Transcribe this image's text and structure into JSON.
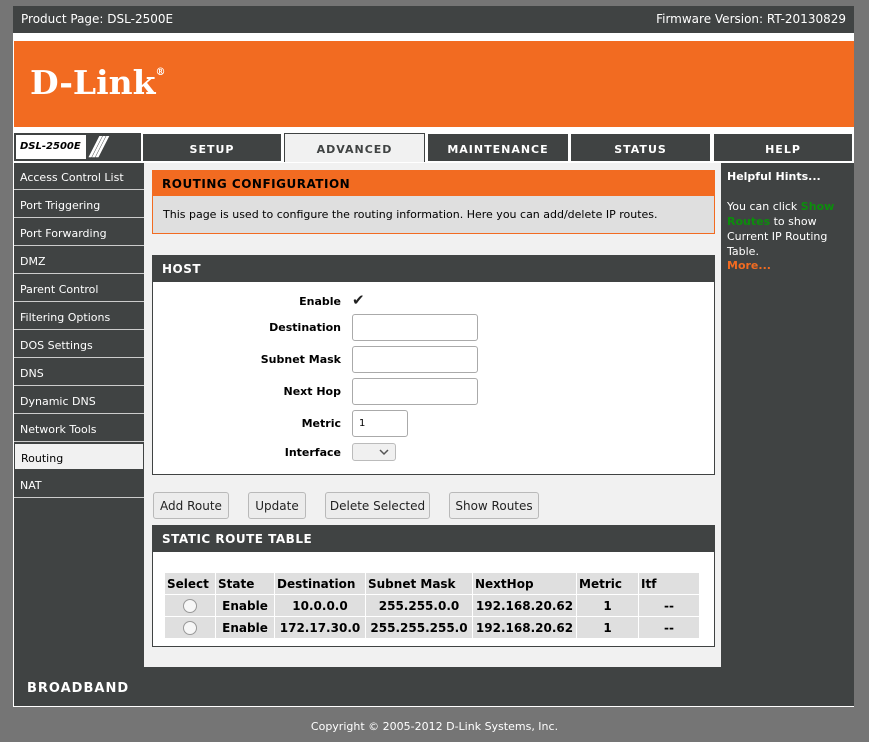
{
  "topbar": {
    "product": "Product Page: DSL-2500E",
    "firmware": "Firmware Version: RT-20130829"
  },
  "brand": {
    "logo": "D-Link",
    "model": "DSL-2500E"
  },
  "tabs": [
    "SETUP",
    "ADVANCED",
    "MAINTENANCE",
    "STATUS",
    "HELP"
  ],
  "active_tab": "ADVANCED",
  "sidebar": {
    "items": [
      "Access Control List",
      "Port Triggering",
      "Port Forwarding",
      "DMZ",
      "Parent Control",
      "Filtering Options",
      "DOS Settings",
      "DNS",
      "Dynamic DNS",
      "Network Tools",
      "Routing",
      "NAT"
    ],
    "active": "Routing"
  },
  "routing": {
    "title": "ROUTING CONFIGURATION",
    "description": "This page is used to configure the routing information. Here you can add/delete IP routes."
  },
  "host": {
    "title": "HOST",
    "enable_label": "Enable",
    "enable_checked": true,
    "destination_label": "Destination",
    "destination_value": "",
    "subnet_label": "Subnet Mask",
    "subnet_value": "",
    "nexthop_label": "Next Hop",
    "nexthop_value": "",
    "metric_label": "Metric",
    "metric_value": "1",
    "interface_label": "Interface",
    "interface_value": ""
  },
  "buttons": {
    "add": "Add Route",
    "update": "Update",
    "delete": "Delete Selected",
    "show": "Show Routes"
  },
  "static_table": {
    "title": "STATIC ROUTE TABLE",
    "columns": [
      "Select",
      "State",
      "Destination",
      "Subnet Mask",
      "NextHop",
      "Metric",
      "Itf"
    ],
    "rows": [
      {
        "state": "Enable",
        "destination": "10.0.0.0",
        "subnet": "255.255.0.0",
        "nexthop": "192.168.20.62",
        "metric": "1",
        "itf": "--"
      },
      {
        "state": "Enable",
        "destination": "172.17.30.0",
        "subnet": "255.255.255.0",
        "nexthop": "192.168.20.62",
        "metric": "1",
        "itf": "--"
      }
    ]
  },
  "hints": {
    "title": "Helpful Hints...",
    "text_before": "You can click ",
    "link": "Show Routes",
    "text_after": " to show Current IP Routing Table.",
    "more": "More..."
  },
  "footer": {
    "brand": "BROADBAND",
    "copyright": "Copyright © 2005-2012 D-Link Systems, Inc."
  },
  "colors": {
    "accent": "#f26b21",
    "dark": "#404343",
    "hint_link": "#0c8d0c"
  }
}
